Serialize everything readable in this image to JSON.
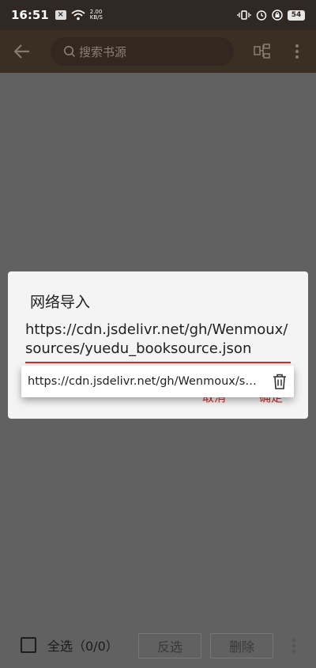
{
  "status": {
    "time": "16:51",
    "speed_value": "2.00",
    "speed_unit": "KB/S",
    "battery": "54",
    "notification_glyph": "×"
  },
  "toolbar": {
    "search_placeholder": "搜索书源"
  },
  "dialog": {
    "title": "网络导入",
    "url_value": "https://cdn.jsdelivr.net/gh/Wenmoux/sources/yuedu_booksource.json",
    "cancel_label": "取消",
    "ok_label": "确定",
    "suggestion": "https://cdn.jsdelivr.net/gh/Wenmoux/sources/yuedu_booksource.json"
  },
  "bottom": {
    "select_all_label": "全选（0/0）",
    "invert_label": "反选",
    "delete_label": "删除"
  },
  "colors": {
    "accent": "#c9302c",
    "toolbar": "#3b2e22",
    "statusbar": "#2f2823",
    "scrim": "#616161"
  }
}
